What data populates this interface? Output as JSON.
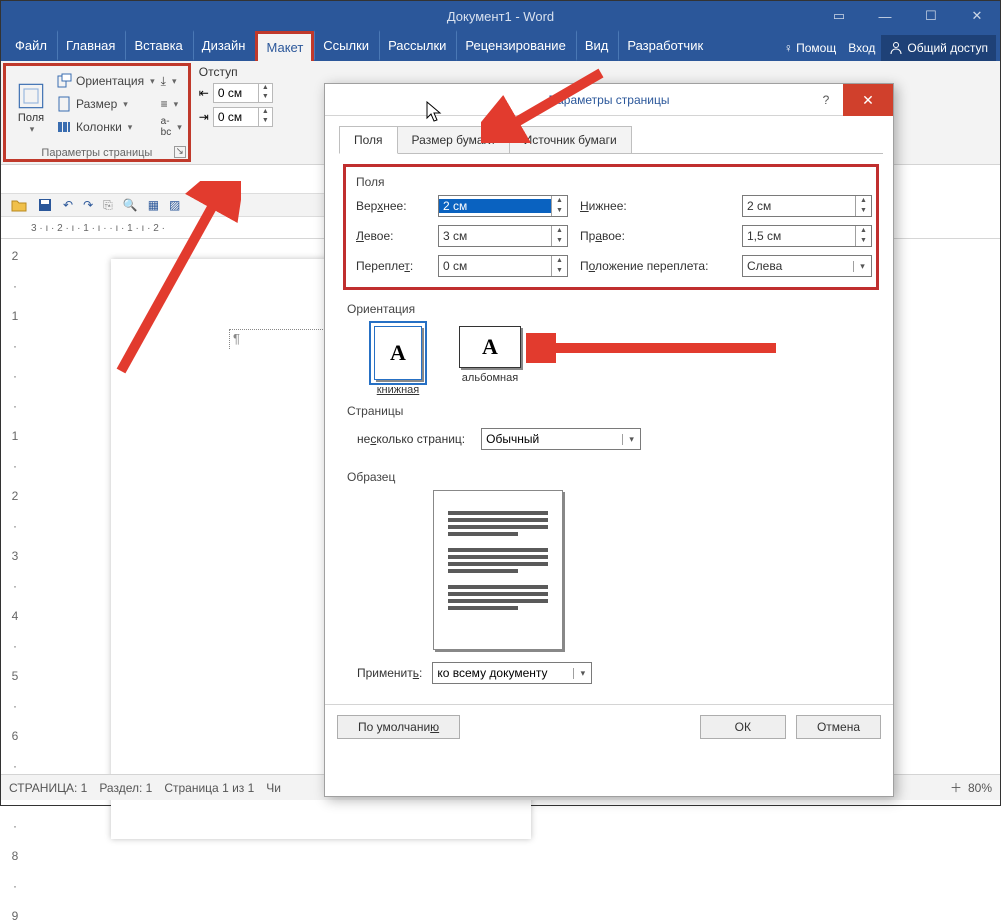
{
  "title": "Документ1 - Word",
  "tabs": {
    "file": "Файл",
    "home": "Главная",
    "insert": "Вставка",
    "design": "Дизайн",
    "layout": "Макет",
    "references": "Ссылки",
    "mailings": "Рассылки",
    "review": "Рецензирование",
    "view": "Вид",
    "developer": "Разработчик",
    "help": "Помощ",
    "signin": "Вход",
    "share": "Общий доступ"
  },
  "ribbon": {
    "group_label": "Параметры страницы",
    "margins": "Поля",
    "orientation": "Ориентация",
    "size": "Размер",
    "columns": "Колонки",
    "indent_label": "Отступ"
  },
  "indent": {
    "left": "0 см",
    "right": "0 см"
  },
  "ruler": "3 · ı · 2 · ı · 1 · ı ·    · ı · 1 · ı · 2 · ",
  "status": {
    "page": "СТРАНИЦА: 1",
    "section": "Раздел: 1",
    "page_of": "Страница 1 из 1",
    "words": "Чи",
    "zoom": "80%"
  },
  "dialog": {
    "title": "Параметры страницы",
    "tabs": {
      "margins": "Поля",
      "paper": "Размер бумаги",
      "source": "Источник бумаги"
    },
    "fields_legend": "Поля",
    "labels": {
      "top": "Вер<u>х</u>нее:",
      "bottom": "<u>Н</u>ижнее:",
      "left": "<u>Л</u>евое:",
      "right": "Пр<u>а</u>вое:",
      "gutter": "Перепле<u>т</u>:",
      "gutter_pos": "П<u>о</u>ложение переплета:"
    },
    "values": {
      "top": "2 см",
      "bottom": "2 см",
      "left": "3 см",
      "right": "1,5 см",
      "gutter": "0 см",
      "gutter_pos": "Слева"
    },
    "orientation": {
      "label": "Ориентация",
      "portrait": "книжная",
      "landscape": "альбомная"
    },
    "pages": {
      "label": "Страницы",
      "multi": "не<u>с</u>колько страниц:",
      "value": "Обычный"
    },
    "sample": "Образец",
    "apply": {
      "label": "Применит<u>ь</u>:",
      "value": "ко всему документу"
    },
    "buttons": {
      "default": "По умолчани<u>ю</u>",
      "ok": "ОК",
      "cancel": "Отмена"
    }
  }
}
